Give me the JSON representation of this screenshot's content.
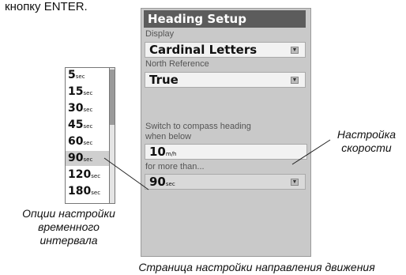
{
  "instruction_fragment": "кнопку ENTER.",
  "screen": {
    "title": "Heading Setup",
    "display_label": "Display",
    "display_value": "Cardinal Letters",
    "north_label": "North Reference",
    "north_value": "True",
    "switch_label_1": "Switch to compass heading",
    "switch_label_2": "when below",
    "speed_value": "10",
    "speed_unit": "m/h",
    "more_than_label": "for more than...",
    "time_value": "90",
    "time_unit": "sec"
  },
  "time_options": [
    {
      "value": "5",
      "unit": "sec"
    },
    {
      "value": "15",
      "unit": "sec"
    },
    {
      "value": "30",
      "unit": "sec"
    },
    {
      "value": "45",
      "unit": "sec"
    },
    {
      "value": "60",
      "unit": "sec"
    },
    {
      "value": "90",
      "unit": "sec",
      "selected": true
    },
    {
      "value": "120",
      "unit": "sec"
    },
    {
      "value": "180",
      "unit": "sec"
    }
  ],
  "captions": {
    "speed_1": "Настройка",
    "speed_2": "скорости",
    "options_1": "Опции настройки",
    "options_2": "временного",
    "options_3": "интервала",
    "page": "Страница настройки направления движения"
  },
  "icons": {
    "dropdown": "dropdown-arrow-icon"
  },
  "colors": {
    "title_bar": "#5c5c5c",
    "screen_bg": "#c9c9c9",
    "selected_option": "#cfcfcf"
  }
}
